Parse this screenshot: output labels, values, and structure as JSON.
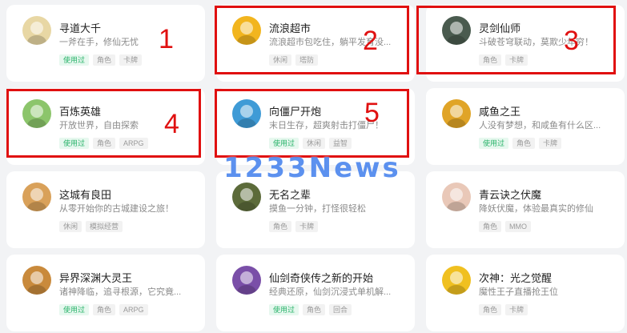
{
  "games": [
    {
      "title": "寻道大千",
      "desc": "一斧在手，修仙无忧",
      "tags": [
        {
          "label": "使用过",
          "used": true
        },
        {
          "label": "角色"
        },
        {
          "label": "卡牌"
        }
      ],
      "avatar_icon": "game-avatar-icon",
      "avatar_color": "#e8d7a4"
    },
    {
      "title": "流浪超市",
      "desc": "流浪超市包吃住，躺平发育没...",
      "tags": [
        {
          "label": "休闲"
        },
        {
          "label": "塔防"
        }
      ],
      "avatar_icon": "game-avatar-icon",
      "avatar_color": "#f2b51e"
    },
    {
      "title": "灵剑仙师",
      "desc": "斗破苍穹联动，莫欺少年穷！",
      "tags": [
        {
          "label": "角色"
        },
        {
          "label": "卡牌"
        }
      ],
      "avatar_icon": "game-avatar-icon",
      "avatar_color": "#4a5b4f"
    },
    {
      "title": "百炼英雄",
      "desc": "开放世界，自由探索",
      "tags": [
        {
          "label": "使用过",
          "used": true
        },
        {
          "label": "角色"
        },
        {
          "label": "ARPG"
        }
      ],
      "avatar_icon": "game-avatar-icon",
      "avatar_color": "#8cc56b"
    },
    {
      "title": "向僵尸开炮",
      "desc": "末日生存，超爽射击打僵尸！",
      "tags": [
        {
          "label": "使用过",
          "used": true
        },
        {
          "label": "休闲"
        },
        {
          "label": "益智"
        }
      ],
      "avatar_icon": "game-avatar-icon",
      "avatar_color": "#3f9bd6"
    },
    {
      "title": "咸鱼之王",
      "desc": "人没有梦想，和咸鱼有什么区...",
      "tags": [
        {
          "label": "使用过",
          "used": true
        },
        {
          "label": "角色"
        },
        {
          "label": "卡牌"
        }
      ],
      "avatar_icon": "game-avatar-icon",
      "avatar_color": "#e0a427"
    },
    {
      "title": "这城有良田",
      "desc": "从零开始你的古城建设之旅！",
      "tags": [
        {
          "label": "休闲"
        },
        {
          "label": "模拟经营"
        }
      ],
      "avatar_icon": "game-avatar-icon",
      "avatar_color": "#d9a15a"
    },
    {
      "title": "无名之辈",
      "desc": "摸鱼一分钟，打怪很轻松",
      "tags": [
        {
          "label": "角色"
        },
        {
          "label": "卡牌"
        }
      ],
      "avatar_icon": "game-avatar-icon",
      "avatar_color": "#5c6b3a"
    },
    {
      "title": "青云诀之伏魔",
      "desc": "降妖伏魔，体验最真实的修仙",
      "tags": [
        {
          "label": "角色"
        },
        {
          "label": "MMO"
        }
      ],
      "avatar_icon": "game-avatar-icon",
      "avatar_color": "#e9c8b8"
    },
    {
      "title": "异界深渊大灵王",
      "desc": "诸神降临，追寻根源，它究竟...",
      "tags": [
        {
          "label": "使用过",
          "used": true
        },
        {
          "label": "角色"
        },
        {
          "label": "ARPG"
        }
      ],
      "avatar_icon": "game-avatar-icon",
      "avatar_color": "#c98a3c"
    },
    {
      "title": "仙剑奇侠传之新的开始",
      "desc": "经典还原，仙剑沉浸式单机解...",
      "tags": [
        {
          "label": "使用过",
          "used": true
        },
        {
          "label": "角色"
        },
        {
          "label": "回合"
        }
      ],
      "avatar_icon": "game-avatar-icon",
      "avatar_color": "#7a4fa8"
    },
    {
      "title": "次神：光之觉醒",
      "desc": "魔性王子直播抢王位",
      "tags": [
        {
          "label": "角色"
        },
        {
          "label": "卡牌"
        }
      ],
      "avatar_icon": "game-avatar-icon",
      "avatar_color": "#f0c020"
    }
  ],
  "highlights": [
    {
      "number": "1"
    },
    {
      "number": "2"
    },
    {
      "number": "3"
    },
    {
      "number": "4"
    },
    {
      "number": "5"
    }
  ],
  "watermark": "1233News",
  "colors": {
    "highlight": "#e01010",
    "tag_used": "#29b36a",
    "watermark": "#4b86ee"
  }
}
